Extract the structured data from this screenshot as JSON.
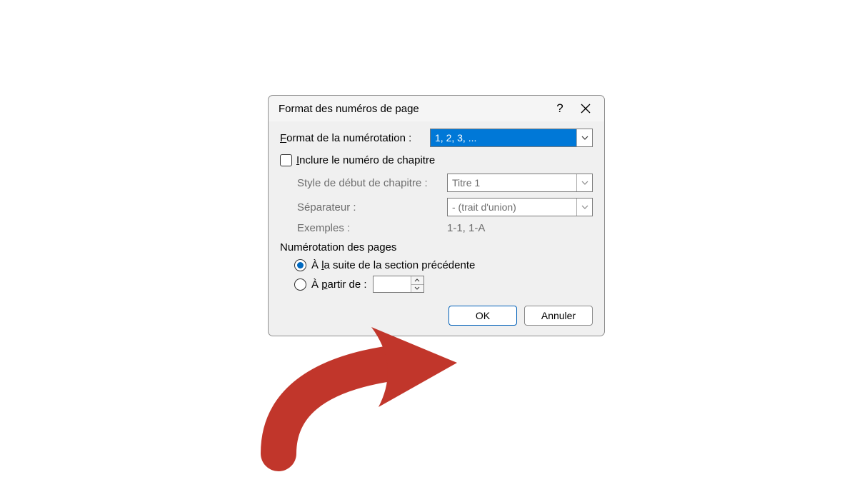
{
  "dialog": {
    "title": "Format des numéros de page",
    "format_label": "Format de la numérotation :",
    "format_value": "1, 2, 3, ...",
    "include_chapter_label": "Inclure le numéro de chapitre",
    "chapter_style_label": "Style de début de chapitre :",
    "chapter_style_value": "Titre 1",
    "separator_label": "Séparateur :",
    "separator_value": "-    (trait d'union)",
    "examples_label": "Exemples :",
    "examples_value": "1-1, 1-A",
    "pagenum_section": "Numérotation des pages",
    "continue_label": "À la suite de la section précédente",
    "start_at_label": "À partir de :",
    "start_at_value": "",
    "ok_label": "OK",
    "cancel_label": "Annuler"
  }
}
